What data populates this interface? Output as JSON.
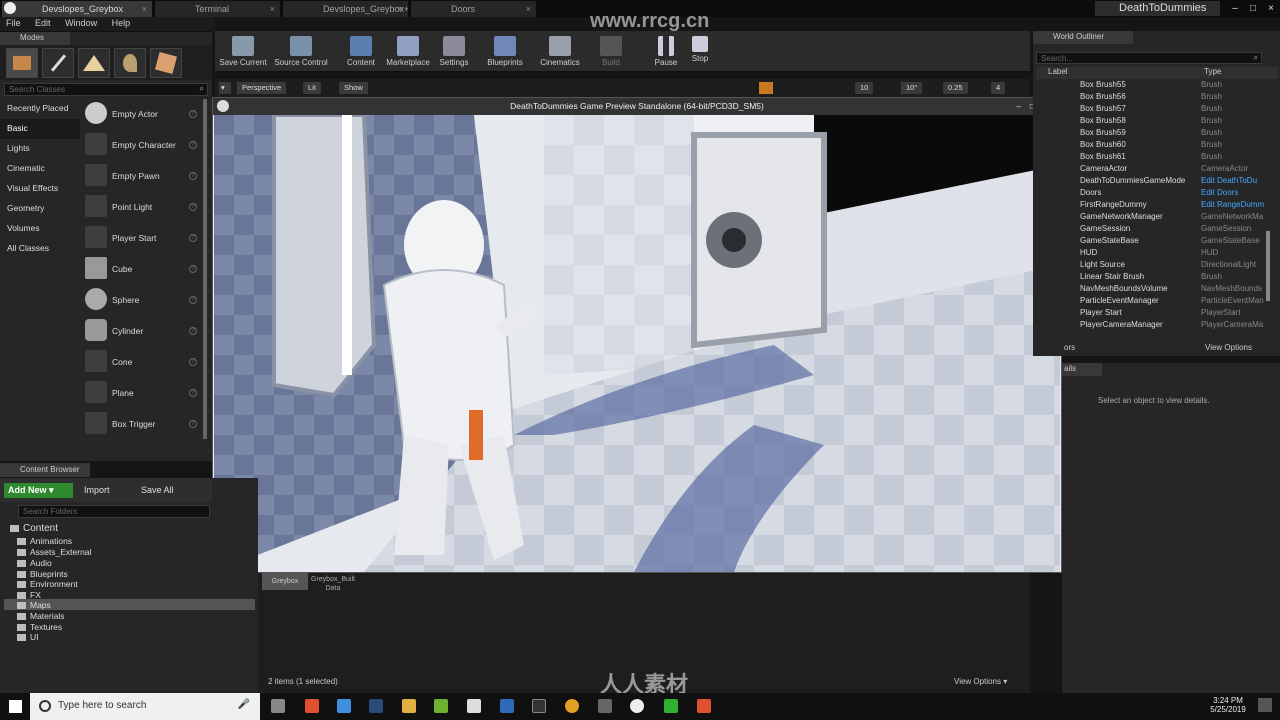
{
  "tabs": [
    {
      "label": "Devslopes_Greybox",
      "close": "×"
    },
    {
      "label": "Terminal",
      "close": "×"
    },
    {
      "label": "Devslopes_Greybox+",
      "close": "×"
    },
    {
      "label": "Doors",
      "close": "×"
    }
  ],
  "project_name": "DeathToDummies",
  "window_controls": {
    "minimize": "–",
    "maximize": "□",
    "close": "×"
  },
  "menu": [
    "File",
    "Edit",
    "Window",
    "Help"
  ],
  "modes": {
    "title": "Modes",
    "search_placeholder": "Search Classes",
    "categories": [
      "Recently Placed",
      "Basic",
      "Lights",
      "Cinematic",
      "Visual Effects",
      "Geometry",
      "Volumes",
      "All Classes"
    ],
    "selected_category": "Basic",
    "items": [
      "Empty Actor",
      "Empty Character",
      "Empty Pawn",
      "Point Light",
      "Player Start",
      "Cube",
      "Sphere",
      "Cylinder",
      "Cone",
      "Plane",
      "Box Trigger"
    ]
  },
  "toolbar": [
    "Save Current",
    "Source Control",
    "Content",
    "Marketplace",
    "Settings",
    "Blueprints",
    "Cinematics",
    "Build",
    "Pause",
    "Stop"
  ],
  "viewport": {
    "perspective": "Perspective",
    "lit": "Lit",
    "show": "Show",
    "grid": "10",
    "angle": "10°",
    "scale": "0.25",
    "cam": "4"
  },
  "game_window": {
    "title": "DeathToDummies Game Preview Standalone (64-bit/PCD3D_SM5)"
  },
  "outliner": {
    "title": "World Outliner",
    "search_placeholder": "Search...",
    "col_label": "Label",
    "col_type": "Type",
    "rows": [
      {
        "label": "Box Brush55",
        "type": "Brush",
        "link": false
      },
      {
        "label": "Box Brush56",
        "type": "Brush",
        "link": false
      },
      {
        "label": "Box Brush57",
        "type": "Brush",
        "link": false
      },
      {
        "label": "Box Brush58",
        "type": "Brush",
        "link": false
      },
      {
        "label": "Box Brush59",
        "type": "Brush",
        "link": false
      },
      {
        "label": "Box Brush60",
        "type": "Brush",
        "link": false
      },
      {
        "label": "Box Brush61",
        "type": "Brush",
        "link": false
      },
      {
        "label": "CameraActor",
        "type": "CameraActor",
        "link": false
      },
      {
        "label": "DeathToDummiesGameMode",
        "type": "Edit DeathToDu",
        "link": true
      },
      {
        "label": "Doors",
        "type": "Edit Doors",
        "link": true
      },
      {
        "label": "FirstRangeDummy",
        "type": "Edit RangeDumm",
        "link": true
      },
      {
        "label": "GameNetworkManager",
        "type": "GameNetworkMa",
        "link": false
      },
      {
        "label": "GameSession",
        "type": "GameSession",
        "link": false
      },
      {
        "label": "GameStateBase",
        "type": "GameStateBase",
        "link": false
      },
      {
        "label": "HUD",
        "type": "HUD",
        "link": false
      },
      {
        "label": "Light Source",
        "type": "DirectionalLight",
        "link": false
      },
      {
        "label": "Linear Stair Brush",
        "type": "Brush",
        "link": false
      },
      {
        "label": "NavMeshBoundsVolume",
        "type": "NavMeshBounds",
        "link": false
      },
      {
        "label": "ParticleEventManager",
        "type": "ParticleEventMan",
        "link": false
      },
      {
        "label": "Player Start",
        "type": "PlayerStart",
        "link": false
      },
      {
        "label": "PlayerCameraManager",
        "type": "PlayerCameraMa",
        "link": false
      }
    ],
    "footer_left": "ors",
    "view_options": "View Options"
  },
  "details": {
    "tab": "ails",
    "empty": "Select an object to view details."
  },
  "content_browser": {
    "title": "Content Browser",
    "add_new": "Add New",
    "import": "Import",
    "save_all": "Save All",
    "search_folders": "Search Folders",
    "root": "Content",
    "folders": [
      "Animations",
      "Assets_External",
      "Audio",
      "Blueprints",
      "Environment",
      "FX",
      "Maps",
      "Materials",
      "Textures",
      "UI"
    ],
    "selected_folder": "Maps",
    "asset_1": "Greybox",
    "asset_2a": "Greybox_Built",
    "asset_2b": "Data",
    "status": "2 items (1 selected)",
    "view_options": "View Options"
  },
  "taskbar": {
    "search": "Type here to search",
    "time": "3:24 PM",
    "date": "5/25/2019"
  },
  "watermark": "www.rrcg.cn",
  "watermark2": "人人素材"
}
